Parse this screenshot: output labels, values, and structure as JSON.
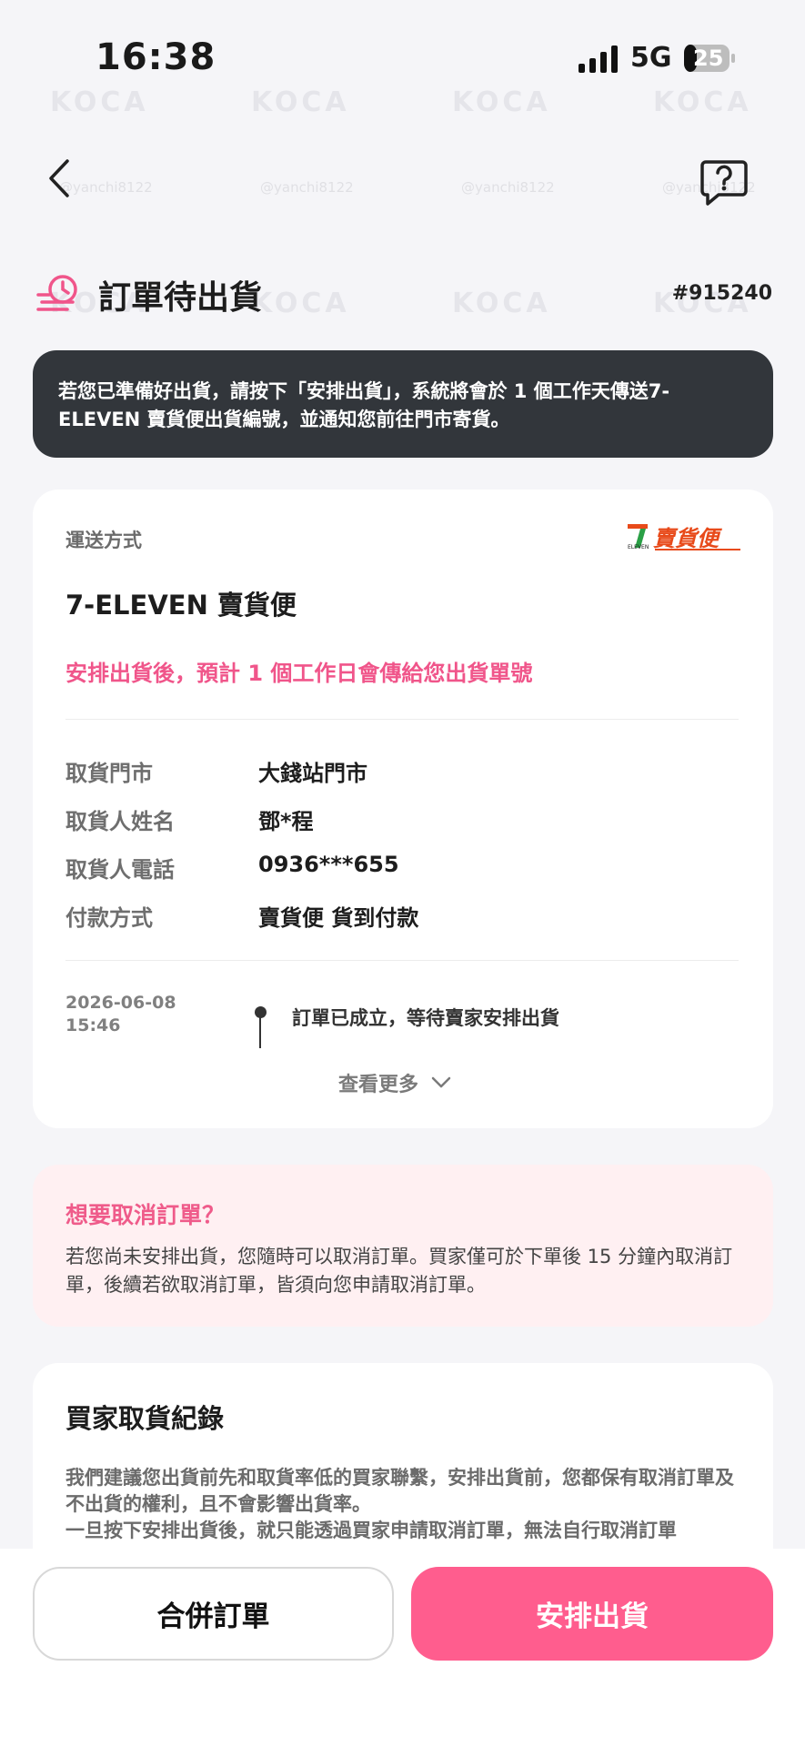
{
  "status_bar": {
    "time": "16:38",
    "network": "5G",
    "battery": "25"
  },
  "header": {
    "title": "訂單待出貨",
    "order_number": "#915240"
  },
  "notice": {
    "text": "若您已準備好出貨，請按下「安排出貨」，系統將會於 1 個工作天傳送7-ELEVEN 賣貨便出貨編號，並通知您前往門市寄貨。"
  },
  "shipping": {
    "label": "運送方式",
    "logo_text": "賣貨便",
    "logo_small": "ELEVEN",
    "method": "7-ELEVEN 賣貨便",
    "hint": "安排出貨後，預計 1 個工作日會傳給您出貨單號",
    "info": [
      {
        "key": "取貨門市",
        "value": "大錢站門市"
      },
      {
        "key": "取貨人姓名",
        "value": "鄧*程"
      },
      {
        "key": "取貨人電話",
        "value": "0936***655"
      },
      {
        "key": "付款方式",
        "value": "賣貨便 貨到付款"
      }
    ],
    "timeline": {
      "date": "2026-06-08 15:46",
      "event": "訂單已成立，等待賣家安排出貨"
    },
    "see_more": "查看更多"
  },
  "cancel": {
    "title": "想要取消訂單？",
    "body": "若您尚未安排出貨，您隨時可以取消訂單。買家僅可於下單後 15 分鐘內取消訂單，後續若欲取消訂單，皆須向您申請取消訂單。"
  },
  "record": {
    "title": "買家取貨紀錄",
    "body_1": "我們建議您出貨前先和取貨率低的買家聯繫，安排出貨前，您都保有取消訂單及不出貨的權利，且不會影響出貨率。",
    "body_2": "一旦按下安排出貨後，就只能透過買家申請取消訂單，無法自行取消訂單"
  },
  "actions": {
    "merge": "合併訂單",
    "ship": "安排出貨"
  },
  "watermark": {
    "logo": "KOCA",
    "handle": "@yanchi8122"
  },
  "colors": {
    "accent_pink": "#ff5d8e",
    "hint_pink": "#f0558a",
    "notice_bg": "#32363b",
    "cancel_bg": "#fff0f2"
  }
}
